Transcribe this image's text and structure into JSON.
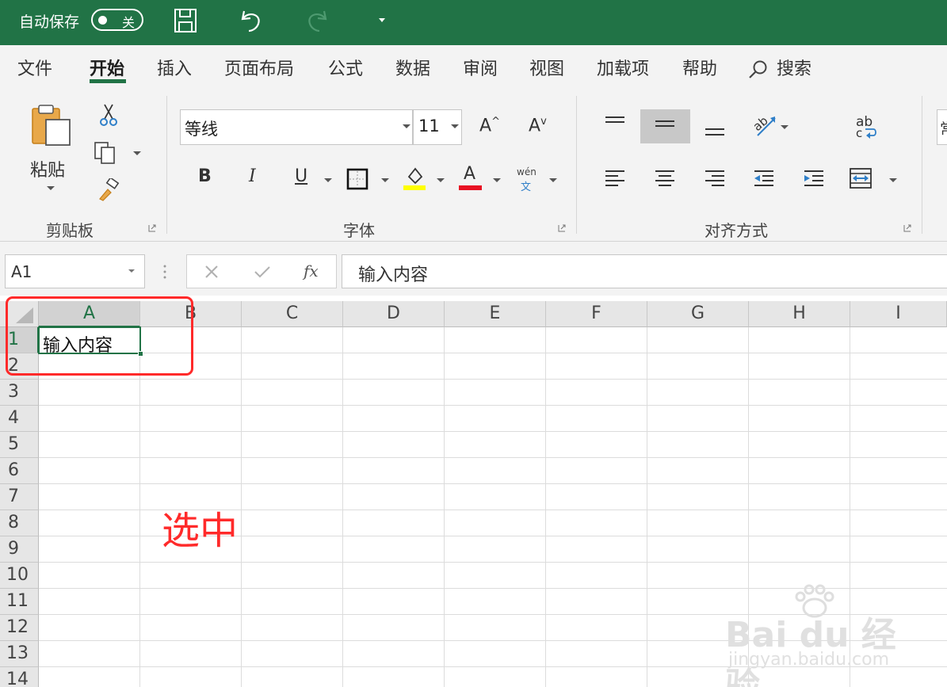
{
  "titlebar": {
    "autosave_label": "自动保存",
    "autosave_state": "关",
    "icons": [
      "save-icon",
      "undo-icon",
      "redo-icon",
      "customize-qat-icon"
    ]
  },
  "ribbon": {
    "tabs": [
      "文件",
      "开始",
      "插入",
      "页面布局",
      "公式",
      "数据",
      "审阅",
      "视图",
      "加载项",
      "帮助",
      "搜索"
    ],
    "active_tab": "开始",
    "clipboard": {
      "paste_label": "粘贴",
      "group_label": "剪贴板"
    },
    "font": {
      "font_name": "等线",
      "font_size": "11",
      "group_label": "字体",
      "increase_label": "A",
      "decrease_label": "A",
      "bold_label": "B",
      "italic_label": "I",
      "underline_label": "U",
      "font_color_label": "A",
      "phonetic_top": "wén",
      "phonetic_bottom": "文"
    },
    "alignment": {
      "group_label": "对齐方式",
      "wrap_label": "ab",
      "wrap_label2": "c"
    },
    "number": {
      "partial_label": "常"
    }
  },
  "formula_bar": {
    "name_box": "A1",
    "fx_label": "fx",
    "formula": "输入内容"
  },
  "sheet": {
    "columns": [
      "A",
      "B",
      "C",
      "D",
      "E",
      "F",
      "G",
      "H",
      "I"
    ],
    "rows": [
      "1",
      "2",
      "3",
      "4",
      "5",
      "6",
      "7",
      "8",
      "9",
      "10",
      "11",
      "12",
      "13",
      "14"
    ],
    "selected_cell": "A1",
    "cell_a1": "输入内容"
  },
  "annotation": {
    "text": "选中",
    "color": "#ff2a2a"
  },
  "watermark": {
    "main": "Bai du 经验",
    "sub": "jingyan.baidu.com"
  },
  "colors": {
    "accent": "#217346"
  }
}
